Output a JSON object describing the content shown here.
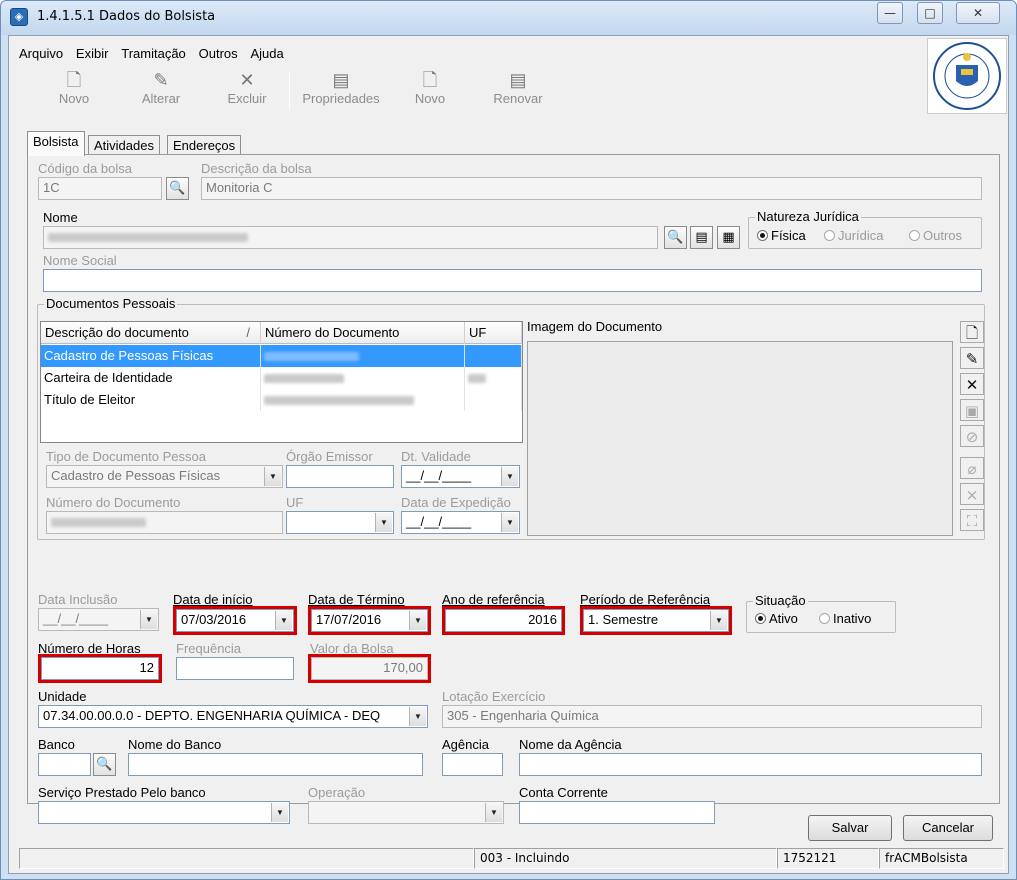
{
  "window": {
    "title": "1.4.1.5.1 Dados do Bolsista",
    "minimize_glyph": "—",
    "maximize_glyph": "□",
    "close_glyph": "✕"
  },
  "menu": [
    "Arquivo",
    "Exibir",
    "Tramitação",
    "Outros",
    "Ajuda"
  ],
  "toolbar": [
    {
      "label": "Novo",
      "icon": "new-document-icon"
    },
    {
      "label": "Alterar",
      "icon": "edit-icon"
    },
    {
      "label": "Excluir",
      "icon": "delete-icon"
    },
    {
      "label": "Propriedades",
      "icon": "properties-icon"
    },
    {
      "label": "Novo",
      "icon": "new-document-icon"
    },
    {
      "label": "Renovar",
      "icon": "renew-icon"
    }
  ],
  "tabs": [
    "Bolsista",
    "Atividades",
    "Endereços"
  ],
  "bolsa": {
    "codigo_label": "Código da bolsa",
    "codigo_value": "1C",
    "descricao_label": "Descrição da bolsa",
    "descricao_value": "Monitoria C"
  },
  "nome": {
    "label": "Nome",
    "value": ""
  },
  "natureza": {
    "label": "Natureza Jurídica",
    "options": [
      {
        "label": "Física",
        "selected": true
      },
      {
        "label": "Jurídica",
        "selected": false
      },
      {
        "label": "Outros",
        "selected": false
      }
    ]
  },
  "nome_social": {
    "label": "Nome Social",
    "value": ""
  },
  "documentos": {
    "label": "Documentos Pessoais",
    "columns": [
      "Descrição do documento",
      "Número do Documento",
      "UF"
    ],
    "sort_glyph": "/",
    "rows": [
      {
        "descricao": "Cadastro de Pessoas Físicas",
        "numero": "",
        "uf": "",
        "selected": true
      },
      {
        "descricao": "Carteira de Identidade",
        "numero": "",
        "uf": "",
        "selected": false
      },
      {
        "descricao": "Título de Eleitor",
        "numero": "",
        "uf": "",
        "selected": false
      }
    ],
    "imagem_label": "Imagem do Documento",
    "tipo_label": "Tipo de Documento Pessoa",
    "tipo_value": "Cadastro de Pessoas Físicas",
    "orgao_label": "Órgão Emissor",
    "orgao_value": "",
    "validade_label": "Dt. Validade",
    "validade_value": "__/__/____",
    "numero_label": "Número do Documento",
    "numero_value": "",
    "uf_label": "UF",
    "uf_value": "",
    "expedicao_label": "Data de Expedição",
    "expedicao_value": "__/__/____"
  },
  "datas": {
    "inclusao_label": "Data Inclusão",
    "inclusao_value": "__/__/____",
    "inicio_label": "Data de início",
    "inicio_value": "07/03/2016",
    "termino_label": "Data de Término",
    "termino_value": "17/07/2016",
    "ano_label": "Ano de referência",
    "ano_value": "2016",
    "periodo_label": "Período de Referência",
    "periodo_value": "1. Semestre"
  },
  "situacao": {
    "label": "Situação",
    "options": [
      {
        "label": "Ativo",
        "selected": true
      },
      {
        "label": "Inativo",
        "selected": false
      }
    ]
  },
  "horas": {
    "label": "Número de Horas",
    "value": "12"
  },
  "frequencia": {
    "label": "Frequência",
    "value": ""
  },
  "valor": {
    "label": "Valor da Bolsa",
    "value": "170,00"
  },
  "unidade": {
    "label": "Unidade",
    "value": "07.34.00.00.0.0 - DEPTO. ENGENHARIA QUÍMICA - DEQ"
  },
  "lotacao": {
    "label": "Lotação Exercício",
    "value": "305 - Engenharia Química"
  },
  "banco": {
    "banco_label": "Banco",
    "banco_value": "",
    "nome_banco_label": "Nome do Banco",
    "nome_banco_value": "",
    "agencia_label": "Agência",
    "agencia_value": "",
    "nome_agencia_label": "Nome da Agência",
    "nome_agencia_value": "",
    "servico_label": "Serviço Prestado Pelo banco",
    "servico_value": "",
    "operacao_label": "Operação",
    "operacao_value": "",
    "conta_label": "Conta Corrente",
    "conta_value": ""
  },
  "buttons": {
    "salvar": "Salvar",
    "cancelar": "Cancelar"
  },
  "statusbar": {
    "modo": "003 - Incluindo",
    "codigo": "1752121",
    "form": "frACMBolsista"
  },
  "colors": {
    "highlight": "#d40000",
    "selection": "#3399ff"
  }
}
